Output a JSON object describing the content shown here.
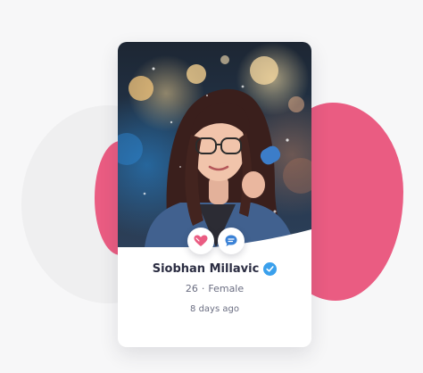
{
  "profile": {
    "name": "Siobhan Millavic",
    "age": "26",
    "separator": "·",
    "gender": "Female",
    "last_active": "8 days ago",
    "verified": true
  },
  "actions": {
    "like_icon": "heart-icon",
    "chat_icon": "chat-bubble-icon"
  },
  "colors": {
    "accent_pink": "#ea5c82",
    "verified_blue": "#3aa0ec",
    "chat_blue": "#3b82d6",
    "text_dark": "#2b2d42",
    "text_muted": "#6b6e82"
  }
}
